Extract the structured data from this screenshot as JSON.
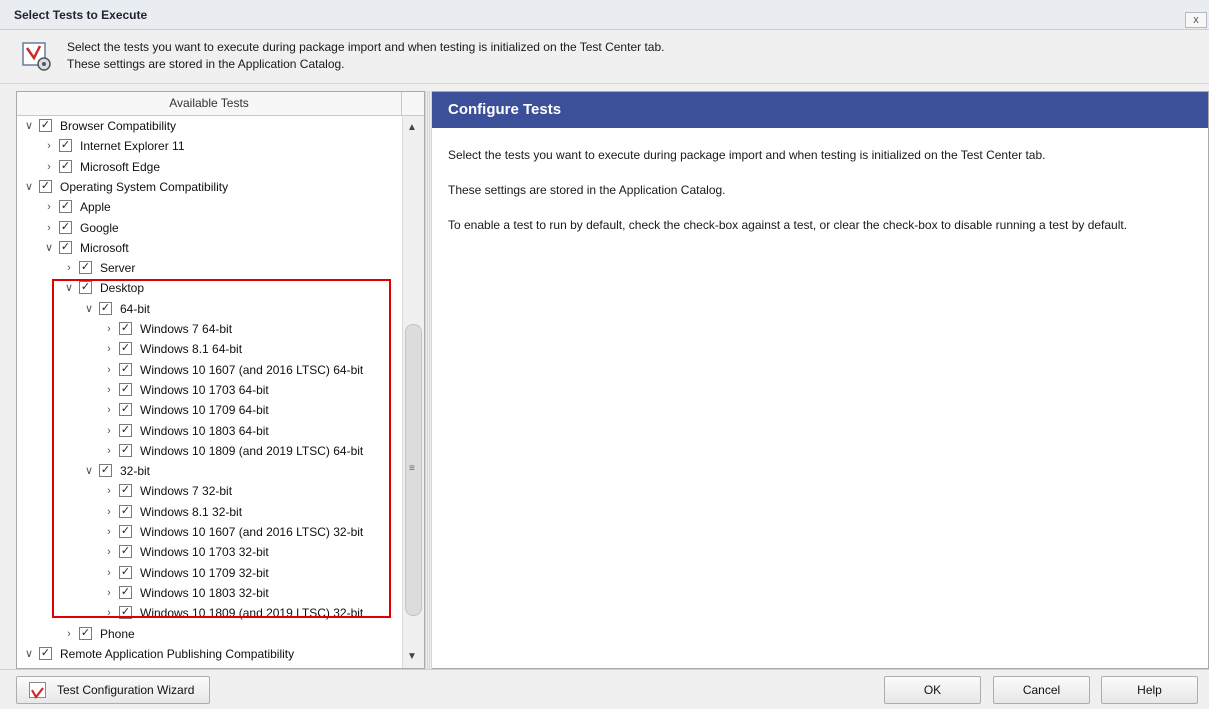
{
  "window": {
    "title": "Select Tests to Execute",
    "close_glyph": "x"
  },
  "description": {
    "icon": "wizard-gear-icon",
    "line1": "Select the tests you want to execute during package import and when testing is initialized on the Test Center tab.",
    "line2": "These settings are stored in the Application Catalog."
  },
  "tree": {
    "header": "Available Tests",
    "items": [
      {
        "level": 0,
        "expanded": true,
        "label": "Browser Compatibility"
      },
      {
        "level": 1,
        "expanded": false,
        "label": "Internet Explorer 11"
      },
      {
        "level": 1,
        "expanded": false,
        "label": "Microsoft Edge"
      },
      {
        "level": 0,
        "expanded": true,
        "label": "Operating System Compatibility"
      },
      {
        "level": 1,
        "expanded": false,
        "label": "Apple"
      },
      {
        "level": 1,
        "expanded": false,
        "label": "Google"
      },
      {
        "level": 1,
        "expanded": true,
        "label": "Microsoft"
      },
      {
        "level": 2,
        "expanded": false,
        "label": "Server"
      },
      {
        "level": 2,
        "expanded": true,
        "label": "Desktop"
      },
      {
        "level": 3,
        "expanded": true,
        "label": "64-bit"
      },
      {
        "level": 4,
        "expanded": false,
        "label": "Windows 7 64-bit"
      },
      {
        "level": 4,
        "expanded": false,
        "label": "Windows 8.1 64-bit"
      },
      {
        "level": 4,
        "expanded": false,
        "label": "Windows 10 1607 (and 2016 LTSC) 64-bit"
      },
      {
        "level": 4,
        "expanded": false,
        "label": "Windows 10 1703 64-bit"
      },
      {
        "level": 4,
        "expanded": false,
        "label": "Windows 10 1709 64-bit"
      },
      {
        "level": 4,
        "expanded": false,
        "label": "Windows 10 1803 64-bit"
      },
      {
        "level": 4,
        "expanded": false,
        "label": "Windows 10 1809 (and 2019 LTSC) 64-bit"
      },
      {
        "level": 3,
        "expanded": true,
        "label": "32-bit"
      },
      {
        "level": 4,
        "expanded": false,
        "label": "Windows 7 32-bit"
      },
      {
        "level": 4,
        "expanded": false,
        "label": "Windows 8.1 32-bit"
      },
      {
        "level": 4,
        "expanded": false,
        "label": "Windows 10 1607 (and 2016 LTSC) 32-bit"
      },
      {
        "level": 4,
        "expanded": false,
        "label": "Windows 10 1703 32-bit"
      },
      {
        "level": 4,
        "expanded": false,
        "label": "Windows 10 1709 32-bit"
      },
      {
        "level": 4,
        "expanded": false,
        "label": "Windows 10 1803 32-bit"
      },
      {
        "level": 4,
        "expanded": false,
        "label": "Windows 10 1809 (and 2019 LTSC) 32-bit"
      },
      {
        "level": 2,
        "expanded": false,
        "label": "Phone"
      },
      {
        "level": 0,
        "expanded": true,
        "label": "Remote Application Publishing Compatibility"
      }
    ]
  },
  "panel": {
    "heading": "Configure Tests",
    "para1": "Select the tests you want to execute during package import and when testing is initialized on the Test Center tab.",
    "para2": "These settings are stored in the Application Catalog.",
    "para3": "To enable a test to run by default, check the check-box against a test, or clear the check-box to disable running a test by default.",
    "accent_color": "#3c509a"
  },
  "footer": {
    "wizard_label": "Test Configuration Wizard",
    "ok_label": "OK",
    "cancel_label": "Cancel",
    "help_label": "Help"
  }
}
